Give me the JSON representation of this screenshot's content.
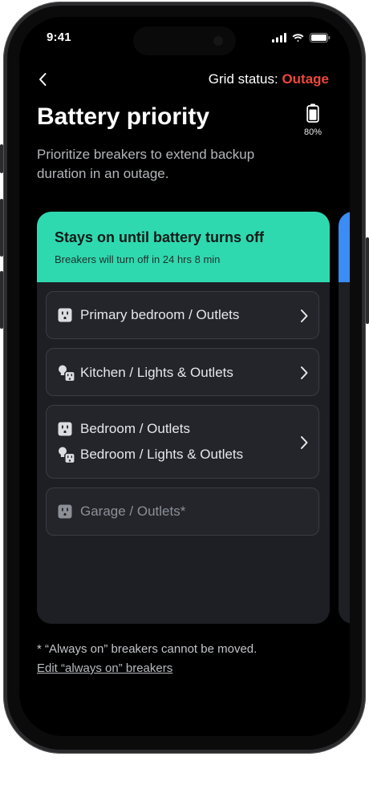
{
  "status_bar": {
    "time": "9:41"
  },
  "header": {
    "grid_status_label": "Grid status:",
    "grid_status_value": "Outage",
    "title": "Battery priority",
    "battery_percent": "80%",
    "subtitle": "Prioritize breakers to extend backup duration in an outage."
  },
  "card": {
    "heading": "Stays on until battery turns off",
    "subheading": "Breakers will turn off in 24 hrs 8 min",
    "items": [
      {
        "label": "Primary bedroom / Outlets",
        "icon": "outlet-icon"
      },
      {
        "label": "Kitchen / Lights & Outlets",
        "icon": "light-outlet-icon"
      },
      {
        "label": "Bedroom / Outlets",
        "icon": "outlet-icon"
      },
      {
        "label": "Bedroom / Lights & Outlets",
        "icon": "light-outlet-icon"
      },
      {
        "label": "Garage / Outlets*",
        "icon": "outlet-icon"
      }
    ]
  },
  "footer": {
    "note": "* “Always on” breakers cannot be moved.",
    "link": "Edit “always on” breakers"
  },
  "colors": {
    "accent_green": "#2fd9b0",
    "next_card_blue": "#3b8cf4",
    "outage_red": "#f0473c",
    "card_bg": "#1d1f24"
  }
}
